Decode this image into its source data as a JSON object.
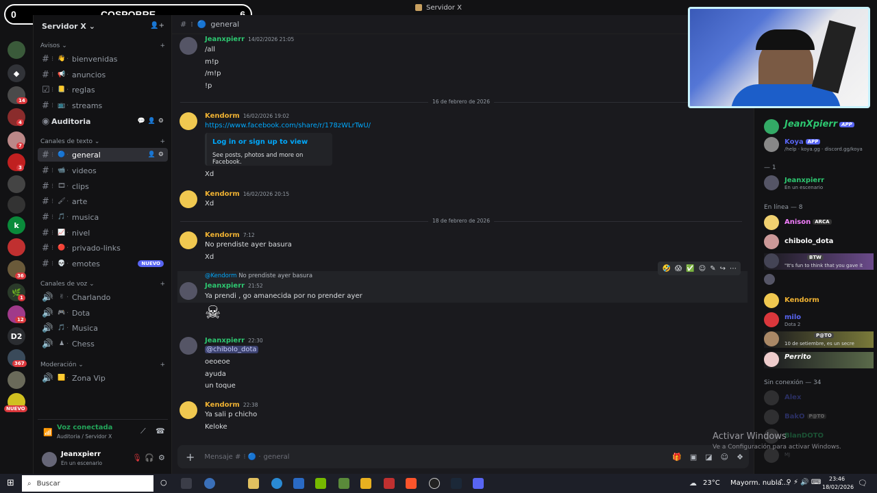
{
  "window": {
    "title": "Servidor X"
  },
  "overlay": {
    "left_score": "0",
    "title": "COSPOBRE",
    "right_score": "6"
  },
  "rail": {
    "badges": [
      "14",
      "4",
      "7",
      "3",
      "36",
      "1",
      "12",
      "367"
    ],
    "d2_label": "D2",
    "nuevo": "NUEVO"
  },
  "server": {
    "name": "Servidor X"
  },
  "categories": {
    "avisos": "Avisos",
    "texto": "Canales de texto",
    "voz": "Canales de voz",
    "moderacion": "Moderación"
  },
  "channels_avisos": [
    {
      "name": "bienvenidas",
      "emoji": "👋"
    },
    {
      "name": "anuncios",
      "emoji": "📢"
    },
    {
      "name": "reglas",
      "emoji": "📒"
    },
    {
      "name": "streams",
      "emoji": "📺"
    }
  ],
  "stage_channel": {
    "name": "Auditoria"
  },
  "channels_texto": [
    {
      "name": "general",
      "emoji": "🔵"
    },
    {
      "name": "videos",
      "emoji": "📹"
    },
    {
      "name": "clips",
      "emoji": "🎞"
    },
    {
      "name": "arte",
      "emoji": "🖌"
    },
    {
      "name": "musica",
      "emoji": "🎵"
    },
    {
      "name": "nivel",
      "emoji": "📈"
    },
    {
      "name": "privado-links",
      "emoji": "🔴"
    },
    {
      "name": "emotes",
      "emoji": "💀"
    }
  ],
  "new_badge": "NUEVO",
  "channels_voz": [
    {
      "name": "Charlando",
      "emoji": "✌"
    },
    {
      "name": "Dota",
      "emoji": "🎮"
    },
    {
      "name": "Musica",
      "emoji": "🎵"
    },
    {
      "name": "Chess",
      "emoji": "♟"
    }
  ],
  "channels_mod": [
    {
      "name": "Zona Vip",
      "emoji": "🟨"
    }
  ],
  "voice": {
    "status": "Voz conectada",
    "location": "Auditoria / Servidor X"
  },
  "user": {
    "name": "Jeanxpierr",
    "status": "En un escenario"
  },
  "chat": {
    "channel": "general",
    "messages": [
      {
        "author": "Jeanxpierr",
        "time": "14/02/2026 21:05",
        "lines": [
          "/all",
          "m!p",
          "/m!p",
          "!p"
        ]
      },
      {
        "divider": "16 de febrero de 2026"
      },
      {
        "author": "Kendorm",
        "time": "16/02/2026 19:02",
        "link": "https://www.facebook.com/share/r/178zWLrTwU/",
        "embed_title": "Log in or sign up to view",
        "embed_desc": "See posts, photos and more on Facebook.",
        "after": "Xd"
      },
      {
        "author": "Kendorm",
        "time": "16/02/2026 20:15",
        "lines": [
          "Xd"
        ]
      },
      {
        "divider": "18 de febrero de 2026"
      },
      {
        "author": "Kendorm",
        "time": "7:12",
        "lines": [
          "No prendiste ayer basura",
          "Xd"
        ]
      },
      {
        "reply_to": "@Kendorm",
        "reply_text": "No prendiste ayer basura",
        "author": "Jeanxpierr",
        "time": "21:52",
        "lines": [
          "Ya prendi , go amanecida por no prender ayer"
        ],
        "sticker": "☠"
      },
      {
        "author": "Jeanxpierr",
        "time": "22:30",
        "mention": "@chibolo_dota",
        "lines": [
          "oeoeoe",
          "ayuda",
          "un toque"
        ]
      },
      {
        "author": "Kendorm",
        "time": "22:38",
        "lines": [
          "Ya sali p chicho",
          "Keloke"
        ]
      }
    ],
    "composer_placeholder": "Mensaje #",
    "composer_channel": "general"
  },
  "members": {
    "bots": [
      {
        "name": "JeanXpierr",
        "tag": "APP"
      },
      {
        "name": "Koya",
        "tag": "APP",
        "status": "/help · koya.gg · discord.gg/koya"
      }
    ],
    "stage_header": "— 1",
    "stage": [
      {
        "name": "Jeanxpierr",
        "status": "En un escenario"
      }
    ],
    "online_header": "En línea — 8",
    "online": [
      {
        "name": "Anison",
        "tag": "ARCA",
        "color": "#f47fff"
      },
      {
        "name": "chibolo_dota",
        "color": "#ffffff"
      },
      {
        "name": "",
        "status": "\"It's fun to think that you gave it",
        "color": "#ffffff",
        "tag": "BTW"
      },
      {
        "name": "",
        "color": "#ffffff"
      },
      {
        "name": "Kendorm",
        "color": "#f0b232"
      },
      {
        "name": "milo",
        "status": "Dota 2",
        "color": "#5865f2"
      },
      {
        "name": "",
        "status": "10 de setiembre, es un secre",
        "tag": "P@TO",
        "color": "#ffffff"
      },
      {
        "name": "Perrito",
        "color": "#ffffff"
      }
    ],
    "offline_header": "Sin conexión — 34",
    "offline": [
      {
        "name": "Alex"
      },
      {
        "name": "BakO",
        "tag": "P@TO"
      },
      {
        "name": "BlanDOTO"
      },
      {
        "name": "",
        "status": "MJ"
      }
    ]
  },
  "watermark": {
    "line1": "Activar Windows",
    "line2": "Ve a Configuración para activar Windows."
  },
  "taskbar": {
    "search": "Buscar",
    "temp": "23°C",
    "weather": "Mayorm. nubla...",
    "time": "23:46",
    "date": "18/02/2026"
  },
  "colors": {
    "kendorm": "#f0b232",
    "jeanx": "#2dc770",
    "link": "#00a8fc",
    "accent": "#5865f2"
  }
}
